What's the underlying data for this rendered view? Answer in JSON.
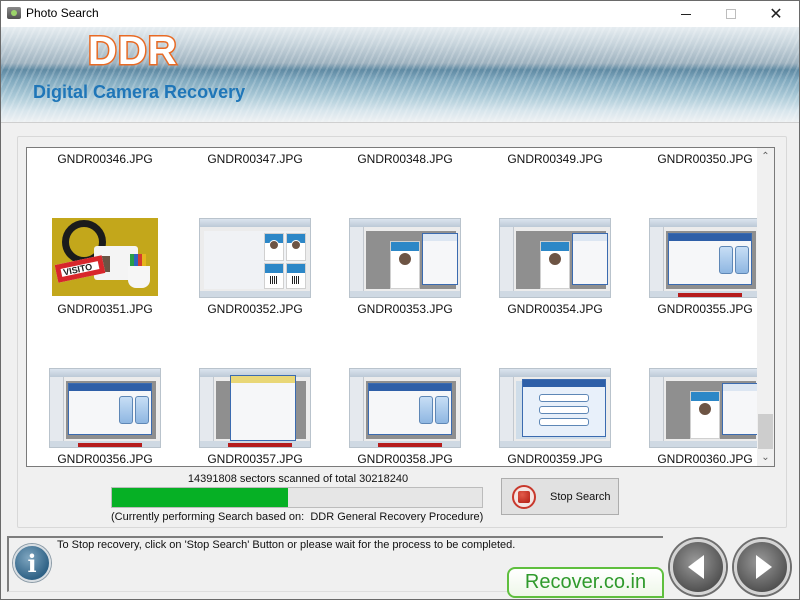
{
  "window": {
    "title": "Photo Search",
    "controls": {
      "minimize": "minimize",
      "maximize": "maximize",
      "close": "✕"
    }
  },
  "banner": {
    "brand": "DDR",
    "subtitle": "Digital Camera Recovery"
  },
  "gallery": {
    "files": [
      {
        "name": "GNDR00346.JPG",
        "thumbnail": "none"
      },
      {
        "name": "GNDR00347.JPG",
        "thumbnail": "none"
      },
      {
        "name": "GNDR00348.JPG",
        "thumbnail": "none"
      },
      {
        "name": "GNDR00349.JPG",
        "thumbnail": "none"
      },
      {
        "name": "GNDR00350.JPG",
        "thumbnail": "none"
      },
      {
        "name": "GNDR00351.JPG",
        "thumbnail": "visitor-badge-photo"
      },
      {
        "name": "GNDR00352.JPG",
        "thumbnail": "id-card-software-screenshot"
      },
      {
        "name": "GNDR00353.JPG",
        "thumbnail": "id-card-designer-screenshot"
      },
      {
        "name": "GNDR00354.JPG",
        "thumbnail": "id-card-designer-screenshot"
      },
      {
        "name": "GNDR00355.JPG",
        "thumbnail": "id-card-wizard-screenshot"
      },
      {
        "name": "GNDR00356.JPG",
        "thumbnail": "id-card-wizard-screenshot"
      },
      {
        "name": "GNDR00357.JPG",
        "thumbnail": "id-card-dialog-screenshot"
      },
      {
        "name": "GNDR00358.JPG",
        "thumbnail": "id-card-wizard-screenshot"
      },
      {
        "name": "GNDR00359.JPG",
        "thumbnail": "id-card-start-screenshot"
      },
      {
        "name": "GNDR00360.JPG",
        "thumbnail": "id-card-designer-screenshot"
      }
    ],
    "visitor_tag_text": "VISITO",
    "scroll_position": 0.9
  },
  "scan": {
    "status": "14391808 sectors scanned of total 30218240",
    "sectors_scanned": 14391808,
    "sectors_total": 30218240,
    "progress_fraction": 0.476,
    "note": "(Currently performing Search based on:  DDR General Recovery Procedure)",
    "progress_color": "#06b025"
  },
  "buttons": {
    "stop_search": "Stop Search",
    "back": "Back",
    "next": "Next"
  },
  "info": {
    "icon_glyph": "i",
    "message": "To Stop recovery, click on 'Stop Search' Button or please wait for the process to be completed."
  },
  "footer": {
    "website": "Recover.co.in"
  },
  "scrollbar": {
    "up_glyph": "⌃",
    "down_glyph": "⌄"
  }
}
